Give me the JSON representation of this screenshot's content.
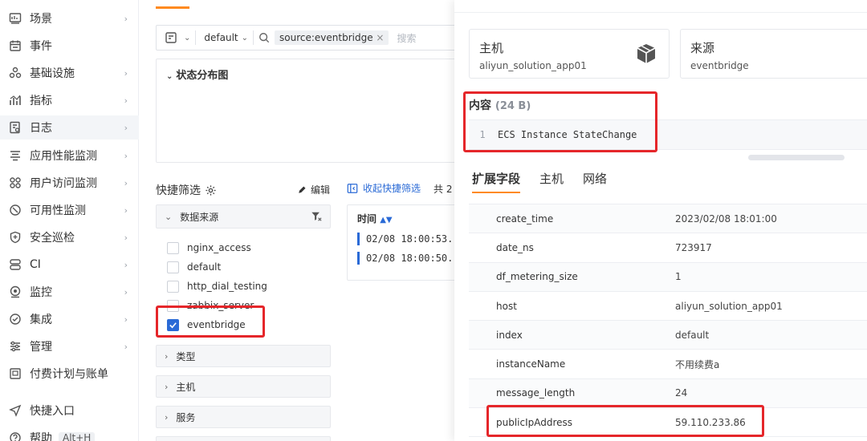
{
  "sidebar": {
    "items": [
      {
        "label": "场景",
        "icon": "dashboard-icon",
        "arrow": true
      },
      {
        "label": "事件",
        "icon": "calendar-icon",
        "arrow": false
      },
      {
        "label": "基础设施",
        "icon": "infrastructure-icon",
        "arrow": true
      },
      {
        "label": "指标",
        "icon": "metrics-icon",
        "arrow": true
      },
      {
        "label": "日志",
        "icon": "log-icon",
        "arrow": true,
        "active": true
      },
      {
        "label": "应用性能监测",
        "icon": "apm-icon",
        "arrow": true
      },
      {
        "label": "用户访问监测",
        "icon": "rum-icon",
        "arrow": true
      },
      {
        "label": "可用性监测",
        "icon": "availability-icon",
        "arrow": true
      },
      {
        "label": "安全巡检",
        "icon": "shield-icon",
        "arrow": true
      },
      {
        "label": "CI",
        "icon": "ci-icon",
        "arrow": true
      },
      {
        "label": "监控",
        "icon": "monitor-icon",
        "arrow": true
      },
      {
        "label": "集成",
        "icon": "integration-icon",
        "arrow": true
      },
      {
        "label": "管理",
        "icon": "settings-icon",
        "arrow": true
      },
      {
        "label": "付费计划与账单",
        "icon": "billing-icon",
        "arrow": false
      }
    ],
    "quick_entry": "快捷入口",
    "help": "帮助",
    "help_shortcut": "Alt+H"
  },
  "middle": {
    "toolbar": {
      "workspace": "default",
      "filter_tag": "source:eventbridge",
      "search_placeholder": "搜索"
    },
    "status_panel_title": "状态分布图",
    "quick_filter": {
      "title": "快捷筛选",
      "edit_label": "编辑",
      "collapse_label": "收起快捷筛选",
      "total_prefix": "共 2",
      "source_group": "数据来源",
      "sources": [
        {
          "label": "nginx_access",
          "checked": false
        },
        {
          "label": "default",
          "checked": false
        },
        {
          "label": "http_dial_testing",
          "checked": false
        },
        {
          "label": "zabbix_server",
          "checked": false
        },
        {
          "label": "eventbridge",
          "checked": true
        }
      ],
      "collapsed_groups": [
        "类型",
        "主机",
        "服务"
      ]
    },
    "log_list": {
      "time_header": "时间",
      "rows": [
        "02/08 18:00:53.",
        "02/08 18:00:50."
      ]
    }
  },
  "drawer": {
    "host_card": {
      "title": "主机",
      "value": "aliyun_solution_app01",
      "icon": "cube-icon"
    },
    "source_card": {
      "title": "来源",
      "value": "eventbridge"
    },
    "content": {
      "label": "内容",
      "size": "(24 B)",
      "line_no": "1",
      "text": "ECS Instance StateChange"
    },
    "tabs": [
      "扩展字段",
      "主机",
      "网络"
    ],
    "fields": [
      {
        "key": "create_time",
        "value": "2023/02/08 18:01:00"
      },
      {
        "key": "date_ns",
        "value": "723917"
      },
      {
        "key": "df_metering_size",
        "value": "1"
      },
      {
        "key": "host",
        "value": "aliyun_solution_app01"
      },
      {
        "key": "index",
        "value": "default"
      },
      {
        "key": "instanceName",
        "value": "不用续费a"
      },
      {
        "key": "message_length",
        "value": "24"
      },
      {
        "key": "publicIpAddress",
        "value": "59.110.233.86"
      }
    ]
  },
  "colors": {
    "accent_orange": "#ff8a1f",
    "primary_blue": "#2a6ad6",
    "highlight_red": "#e5262a"
  }
}
